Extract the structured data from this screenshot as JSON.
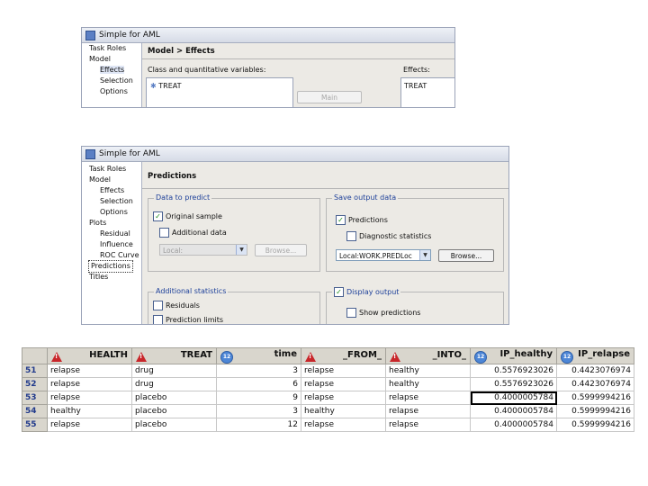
{
  "window1": {
    "title": "Simple for AML",
    "tree": [
      "Task Roles",
      "Model",
      "Effects",
      "Selection",
      "Options"
    ],
    "heading": "Model > Effects",
    "vars_label": "Class and quantitative variables:",
    "effects_label": "Effects:",
    "var_item": "TREAT",
    "main_button": "Main",
    "effect_item": "TREAT"
  },
  "window2": {
    "title": "Simple for AML",
    "tree": [
      "Task Roles",
      "Model",
      "Effects",
      "Selection",
      "Options",
      "Plots",
      "Residual",
      "Influence",
      "ROC Curve",
      "Predictions",
      "Titles"
    ],
    "heading": "Predictions",
    "data_panel": {
      "title": "Data to predict",
      "original": "Original sample",
      "additional": "Additional data",
      "combo_value": "Local:",
      "browse": "Browse..."
    },
    "save_panel": {
      "title": "Save output data",
      "predictions": "Predictions",
      "diagnostic": "Diagnostic statistics",
      "combo_value": "Local:WORK.PREDLoc",
      "browse": "Browse..."
    },
    "stats_panel": {
      "title": "Additional statistics",
      "residuals": "Residuals",
      "limits": "Prediction limits"
    },
    "display_panel": {
      "title": "Display output",
      "show": "Show predictions"
    }
  },
  "table": {
    "columns": [
      "HEALTH",
      "TREAT",
      "time",
      "_FROM_",
      "_INTO_",
      "IP_healthy",
      "IP_relapse"
    ],
    "column_types": [
      "char",
      "char",
      "num",
      "char",
      "char",
      "num",
      "num"
    ],
    "rows": [
      [
        "51",
        "relapse",
        "drug",
        "3",
        "relapse",
        "healthy",
        "0.5576923026",
        "0.4423076974"
      ],
      [
        "52",
        "relapse",
        "drug",
        "6",
        "relapse",
        "healthy",
        "0.5576923026",
        "0.4423076974"
      ],
      [
        "53",
        "relapse",
        "placebo",
        "9",
        "relapse",
        "relapse",
        "0.4000005784",
        "0.5999994216"
      ],
      [
        "54",
        "healthy",
        "placebo",
        "3",
        "healthy",
        "relapse",
        "0.4000005784",
        "0.5999994216"
      ],
      [
        "55",
        "relapse",
        "placebo",
        "12",
        "relapse",
        "relapse",
        "0.4000005784",
        "0.5999994216"
      ]
    ]
  }
}
